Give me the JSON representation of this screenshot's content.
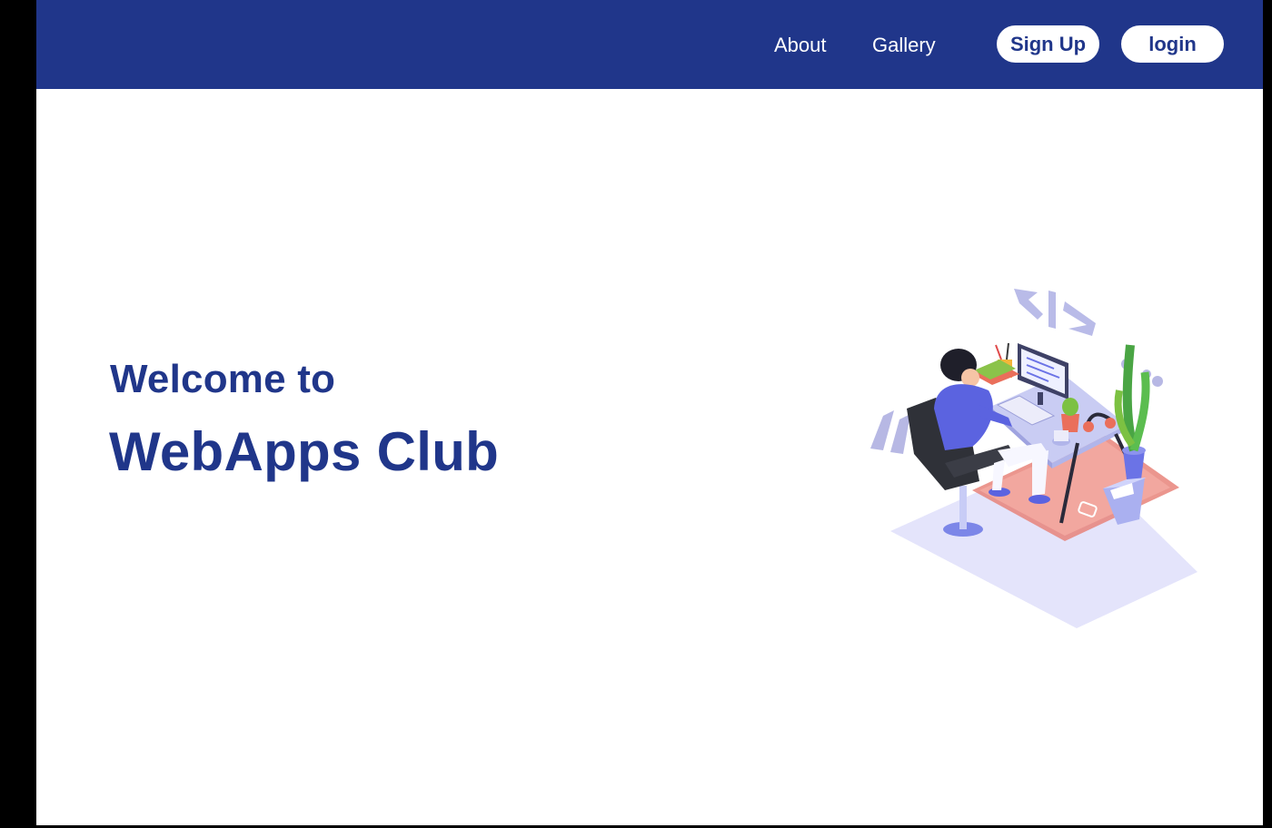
{
  "nav": {
    "links": [
      {
        "label": "About"
      },
      {
        "label": "Gallery"
      }
    ],
    "signup_label": "Sign Up",
    "login_label": "login"
  },
  "hero": {
    "subtitle": "Welcome to",
    "title": "WebApps Club"
  },
  "colors": {
    "primary": "#20368a",
    "accent_purple": "#5b63e0",
    "rug": "#e8847a",
    "floor": "#e4e4fb"
  },
  "illustration": {
    "code_symbol": "</>",
    "icon_name": "developer-at-desk-illustration"
  }
}
